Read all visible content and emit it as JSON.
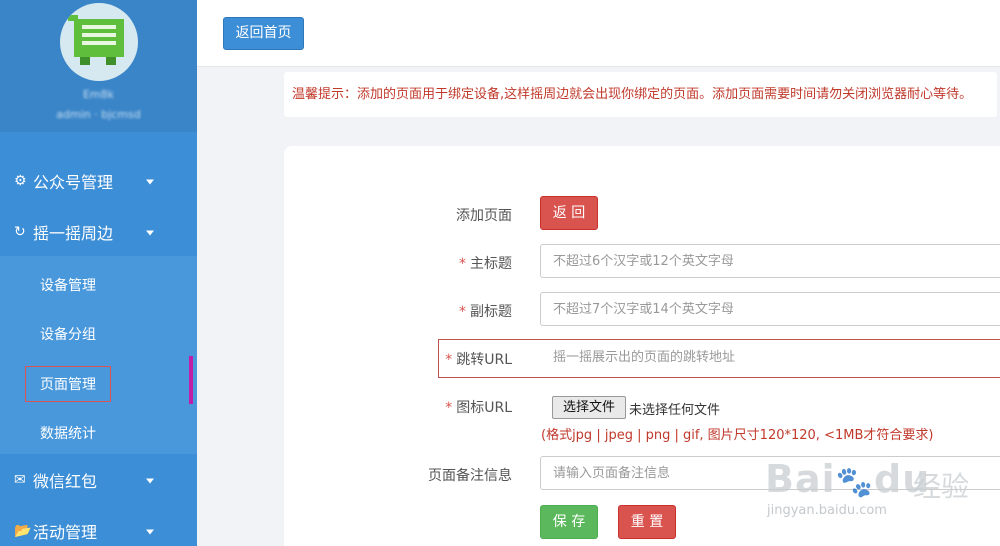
{
  "sidebar": {
    "user_name": "Em8k",
    "user_role": "admin · bjcmsd",
    "menu": [
      {
        "icon": "gear-icon",
        "glyph": "⚙",
        "label": "公众号管理"
      },
      {
        "icon": "refresh-icon",
        "glyph": "↻",
        "label": "摇一摇周边"
      },
      {
        "icon": "envelope-icon",
        "glyph": "✉",
        "label": "微信红包"
      },
      {
        "icon": "folder-open-icon",
        "glyph": "📂",
        "label": "活动管理"
      }
    ],
    "submenu": [
      {
        "label": "设备管理"
      },
      {
        "label": "设备分组"
      },
      {
        "label": "页面管理",
        "active": true
      },
      {
        "label": "数据统计"
      }
    ]
  },
  "topbar": {
    "home_button": "返回首页"
  },
  "tip": "温馨提示：添加的页面用于绑定设备,这样摇周边就会出现你绑定的页面。添加页面需要时间请勿关闭浏览器耐心等待。",
  "form": {
    "add_page_label": "添加页面",
    "back_button": "返 回",
    "required_mark": "*",
    "title_label": "主标题",
    "title_placeholder": "不超过6个汉字或12个英文字母",
    "subtitle_label": "副标题",
    "subtitle_placeholder": "不超过7个汉字或14个英文字母",
    "url_label": "跳转URL",
    "url_placeholder": "摇一摇展示出的页面的跳转地址",
    "icon_label": "图标URL",
    "file_button": "选择文件",
    "file_status": "未选择任何文件",
    "file_hint": "(格式jpg | jpeg | png | gif, 图片尺寸120*120, <1MB才符合要求)",
    "remark_label": "页面备注信息",
    "remark_placeholder": "请输入页面备注信息",
    "save_button": "保 存",
    "reset_button": "重 置"
  },
  "watermark": {
    "brand": "Bai",
    "brand2": "du",
    "cn": "经验",
    "url": "jingyan.baidu.com"
  },
  "colors": {
    "sidebar": "#3c8ed6",
    "primary": "#3c8ed6",
    "danger": "#d9534f",
    "success": "#5cb85c",
    "highlight": "#c11ea8"
  }
}
